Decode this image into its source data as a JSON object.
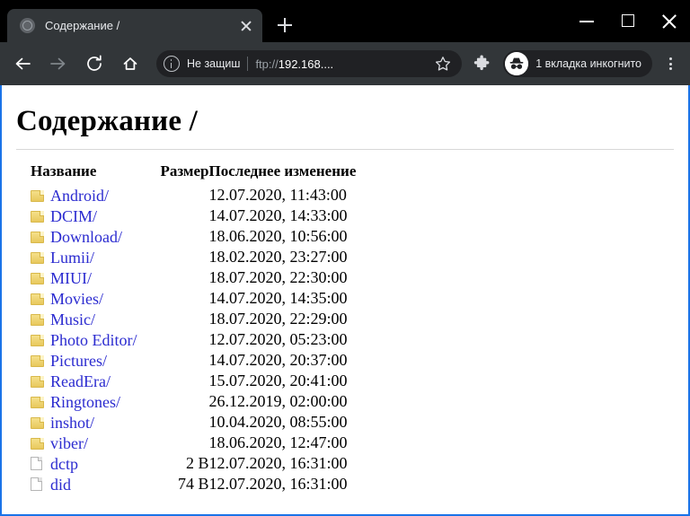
{
  "browser": {
    "tab": {
      "title": "Содержание /",
      "favicon": "globe-icon",
      "close_label": "×"
    },
    "new_tab_label": "+",
    "window_controls": {
      "minimize": "—",
      "maximize": "□",
      "close": "×"
    },
    "toolbar": {
      "back": "back-arrow",
      "forward": "forward-arrow",
      "reload": "reload-icon",
      "home": "home-icon",
      "security_text": "Не защиш",
      "url_scheme": "ftp://",
      "url_host": "192.168....",
      "bookmark": "star-icon",
      "extensions": "puzzle-icon",
      "incognito_label": "1 вкладка инкогнито",
      "menu": "kebab-menu"
    }
  },
  "page": {
    "title": "Содержание /",
    "table": {
      "headers": {
        "name": "Название",
        "size": "Размер",
        "date": "Последнее изменение"
      },
      "rows": [
        {
          "icon": "folder-icon",
          "name": "Android/",
          "size": "",
          "date": "12.07.2020, 11:43:00"
        },
        {
          "icon": "folder-icon",
          "name": "DCIM/",
          "size": "",
          "date": "14.07.2020, 14:33:00"
        },
        {
          "icon": "folder-icon",
          "name": "Download/",
          "size": "",
          "date": "18.06.2020, 10:56:00"
        },
        {
          "icon": "folder-icon",
          "name": "Lumii/",
          "size": "",
          "date": "18.02.2020, 23:27:00"
        },
        {
          "icon": "folder-icon",
          "name": "MIUI/",
          "size": "",
          "date": "18.07.2020, 22:30:00"
        },
        {
          "icon": "folder-icon",
          "name": "Movies/",
          "size": "",
          "date": "14.07.2020, 14:35:00"
        },
        {
          "icon": "folder-icon",
          "name": "Music/",
          "size": "",
          "date": "18.07.2020, 22:29:00"
        },
        {
          "icon": "folder-icon",
          "name": "Photo Editor/",
          "size": "",
          "date": "12.07.2020, 05:23:00"
        },
        {
          "icon": "folder-icon",
          "name": "Pictures/",
          "size": "",
          "date": "14.07.2020, 20:37:00"
        },
        {
          "icon": "folder-icon",
          "name": "ReadEra/",
          "size": "",
          "date": "15.07.2020, 20:41:00"
        },
        {
          "icon": "folder-icon",
          "name": "Ringtones/",
          "size": "",
          "date": "26.12.2019, 02:00:00"
        },
        {
          "icon": "folder-icon",
          "name": "inshot/",
          "size": "",
          "date": "10.04.2020, 08:55:00"
        },
        {
          "icon": "folder-icon",
          "name": "viber/",
          "size": "",
          "date": "18.06.2020, 12:47:00"
        },
        {
          "icon": "file-icon",
          "name": "dctp",
          "size": "2 B",
          "date": "12.07.2020, 16:31:00"
        },
        {
          "icon": "file-icon",
          "name": "did",
          "size": "74 B",
          "date": "12.07.2020, 16:31:00"
        }
      ]
    }
  },
  "colors": {
    "tab_bar_bg": "#000000",
    "tab_active_bg": "#323639",
    "toolbar_bg": "#323639",
    "omnibox_bg": "#202124",
    "page_bg": "#ffffff",
    "link": "#2b2bd0",
    "viewport_border": "#1a73e8",
    "folder": "#e8c85d"
  }
}
